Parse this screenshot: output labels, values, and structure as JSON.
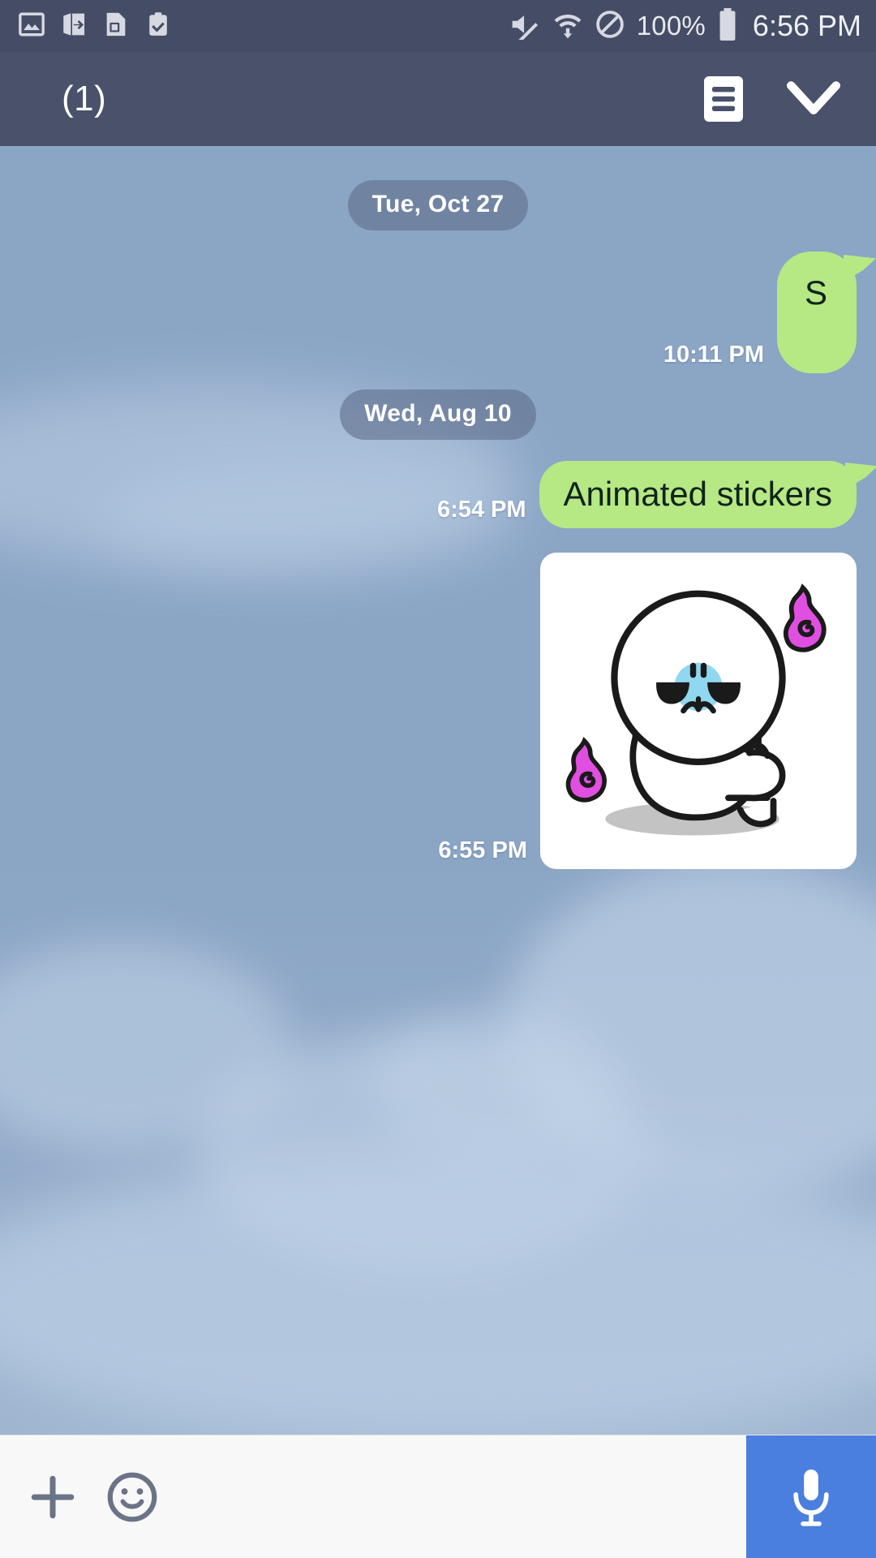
{
  "status_bar": {
    "left_icons": [
      {
        "name": "image-saved-icon",
        "label": "image"
      },
      {
        "name": "file-transfer-icon",
        "label": "transfer"
      },
      {
        "name": "sim-card-alert-icon",
        "label": "sim alert"
      },
      {
        "name": "clipboard-check-icon",
        "label": "task done"
      }
    ],
    "right_icons": [
      {
        "name": "mute-icon",
        "label": "silent"
      },
      {
        "name": "wifi-data-icon",
        "label": "wifi"
      },
      {
        "name": "do-not-disturb-icon",
        "label": "blocked"
      }
    ],
    "battery_percent": "100%",
    "clock": "6:56 PM"
  },
  "header": {
    "title": "(1)",
    "menu_icon": "notes-list-icon",
    "collapse_icon": "chevron-down-icon"
  },
  "chat": {
    "items": [
      {
        "kind": "date",
        "text": "Tue, Oct 27"
      },
      {
        "kind": "text",
        "side": "out",
        "text": "S",
        "time": "10:11 PM",
        "short": true
      },
      {
        "kind": "date",
        "text": "Wed, Aug 10"
      },
      {
        "kind": "text",
        "side": "out",
        "text": "Animated stickers",
        "time": "6:54 PM",
        "short": false
      },
      {
        "kind": "sticker",
        "side": "out",
        "time": "6:55 PM",
        "sticker_name": "angry-white-character-sticker"
      }
    ]
  },
  "input_bar": {
    "add_icon": "plus-icon",
    "emoji_icon": "smiley-face-icon",
    "placeholder": "",
    "value": "",
    "mic_icon": "microphone-icon"
  },
  "colors": {
    "status_bar_bg": "#454d66",
    "header_bg": "#49516b",
    "bubble_out": "#b6e884",
    "mic_button": "#4a7fe0",
    "wallpaper_sky": "#8ba5c5",
    "date_chip": "#5f708c"
  }
}
